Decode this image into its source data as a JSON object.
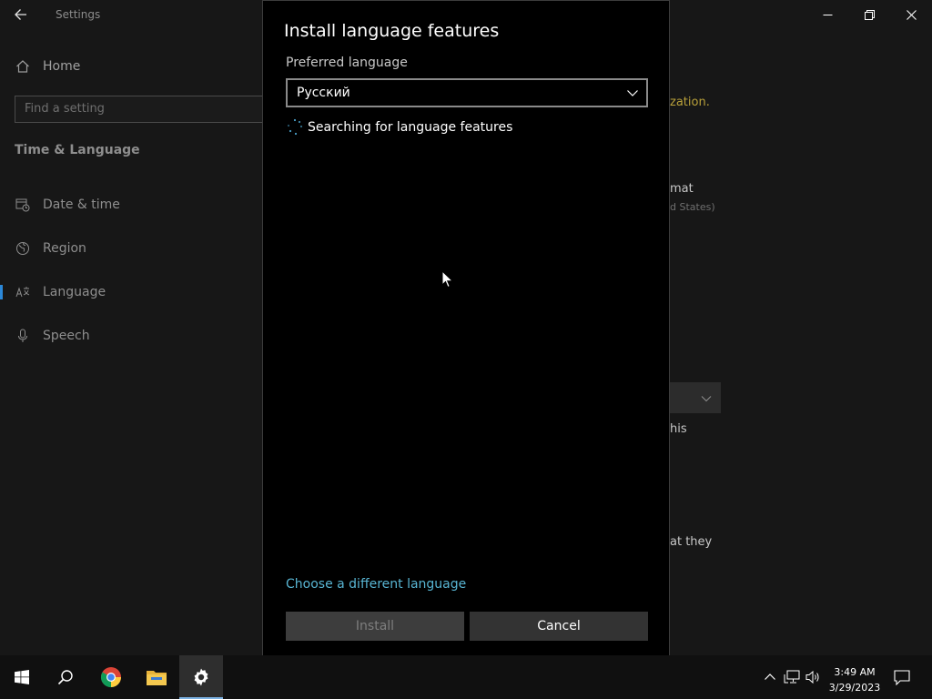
{
  "window": {
    "title": "Settings",
    "back_icon": "back-arrow-icon",
    "controls": [
      "minimize-icon",
      "restore-icon",
      "close-icon"
    ]
  },
  "sidebar": {
    "home": {
      "label": "Home",
      "icon": "home-icon"
    },
    "search": {
      "placeholder": "Find a setting",
      "icon": "search-icon"
    },
    "section_title": "Time & Language",
    "items": [
      {
        "label": "Date & time",
        "icon": "calendar-clock-icon",
        "active": false
      },
      {
        "label": "Region",
        "icon": "globe-icon",
        "active": false
      },
      {
        "label": "Language",
        "icon": "language-icon",
        "active": true
      },
      {
        "label": "Speech",
        "icon": "microphone-icon",
        "active": false
      }
    ],
    "active_indicator_color": "#2b88d8"
  },
  "content_peek": {
    "line_1": "zation.",
    "line_2": "mat",
    "line_3": "d States)",
    "line_4": "his",
    "line_5": "at they"
  },
  "dialog": {
    "title": "Install language features",
    "preferred_label": "Preferred language",
    "selected_language": "Русский",
    "status": "Searching for language features",
    "link": "Choose a different language",
    "install_label": "Install",
    "install_enabled": false,
    "cancel_label": "Cancel",
    "link_color": "#58b5d3"
  },
  "taskbar": {
    "apps": [
      {
        "name": "Start",
        "icon": "windows-start-icon",
        "active": false
      },
      {
        "name": "Search",
        "icon": "search-icon",
        "active": false
      },
      {
        "name": "Google Chrome",
        "icon": "chrome-icon",
        "active": false
      },
      {
        "name": "File Explorer",
        "icon": "folder-icon",
        "active": false
      },
      {
        "name": "Settings",
        "icon": "gear-icon",
        "active": true
      }
    ],
    "tray": [
      "chevron-up-icon",
      "network-icon",
      "volume-icon"
    ],
    "clock": {
      "time": "3:49 AM",
      "date": "3/29/2023"
    },
    "notification_icon": "action-center-icon"
  }
}
